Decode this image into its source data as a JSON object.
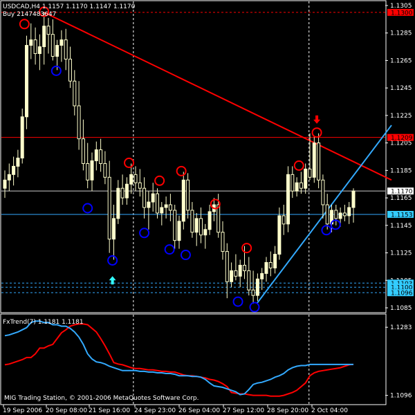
{
  "chart_data": [
    {
      "type": "candlestick",
      "title": "USDCAD,H4  1.1157 1.1170 1.1147 1.1170",
      "order_label": "Buy 2147483647",
      "copyright": "MIG Trading Station, © 2001-2006 MetaQuotes Software Corp.",
      "ylim": [
        1.1082,
        1.1308
      ],
      "y_ticks": [
        "1.1305",
        "1.1285",
        "1.1265",
        "1.1245",
        "1.1225",
        "1.1205",
        "1.1185",
        "1.1165",
        "1.1145",
        "1.1125",
        "1.1105",
        "1.1085"
      ],
      "x_ticks": [
        "19 Sep 2006",
        "20 Sep 08:00",
        "21 Sep 16:00",
        "24 Sep 23:00",
        "26 Sep 04:00",
        "27 Sep 12:00",
        "28 Sep 20:00",
        "2 Oct 04:00"
      ],
      "price_tags": [
        {
          "label": "1.1300",
          "value": 1.13,
          "color": "#ff0000",
          "text_color": "#000000"
        },
        {
          "label": "1.1209",
          "value": 1.1209,
          "color": "#ff0000",
          "text_color": "#000000"
        },
        {
          "label": "1.1170",
          "value": 1.117,
          "color": "#ffffff",
          "text_color": "#000000"
        },
        {
          "label": "1.1153",
          "value": 1.1153,
          "color": "#33ccff",
          "text_color": "#000000"
        },
        {
          "label": "1.1103",
          "value": 1.1103,
          "color": "#33ccff",
          "text_color": "#000000"
        },
        {
          "label": "1.1100",
          "value": 1.11,
          "color": "#33ccff",
          "text_color": "#000000"
        },
        {
          "label": "1.1096",
          "value": 1.1096,
          "color": "#33ccff",
          "text_color": "#000000"
        }
      ],
      "candles": [
        {
          "o": 1.1172,
          "h": 1.1185,
          "l": 1.1165,
          "c": 1.1178
        },
        {
          "o": 1.1178,
          "h": 1.119,
          "l": 1.117,
          "c": 1.1182
        },
        {
          "o": 1.1182,
          "h": 1.1195,
          "l": 1.1174,
          "c": 1.1188
        },
        {
          "o": 1.1188,
          "h": 1.12,
          "l": 1.118,
          "c": 1.1194
        },
        {
          "o": 1.1194,
          "h": 1.123,
          "l": 1.119,
          "c": 1.1224
        },
        {
          "o": 1.1224,
          "h": 1.1283,
          "l": 1.1215,
          "c": 1.1276
        },
        {
          "o": 1.1276,
          "h": 1.1292,
          "l": 1.1266,
          "c": 1.128
        },
        {
          "o": 1.128,
          "h": 1.1289,
          "l": 1.1262,
          "c": 1.127
        },
        {
          "o": 1.127,
          "h": 1.1284,
          "l": 1.1258,
          "c": 1.1275
        },
        {
          "o": 1.1275,
          "h": 1.13,
          "l": 1.1262,
          "c": 1.129
        },
        {
          "o": 1.129,
          "h": 1.1296,
          "l": 1.127,
          "c": 1.1284
        },
        {
          "o": 1.1284,
          "h": 1.1295,
          "l": 1.1265,
          "c": 1.1268
        },
        {
          "o": 1.1268,
          "h": 1.128,
          "l": 1.1258,
          "c": 1.1276
        },
        {
          "o": 1.1276,
          "h": 1.1287,
          "l": 1.1264,
          "c": 1.128
        },
        {
          "o": 1.128,
          "h": 1.1288,
          "l": 1.1258,
          "c": 1.1266
        },
        {
          "o": 1.1266,
          "h": 1.1275,
          "l": 1.1245,
          "c": 1.125
        },
        {
          "o": 1.125,
          "h": 1.1258,
          "l": 1.1225,
          "c": 1.1232
        },
        {
          "o": 1.1232,
          "h": 1.125,
          "l": 1.12,
          "c": 1.1208
        },
        {
          "o": 1.1208,
          "h": 1.1222,
          "l": 1.1185,
          "c": 1.119
        },
        {
          "o": 1.119,
          "h": 1.1205,
          "l": 1.1172,
          "c": 1.1178
        },
        {
          "o": 1.1178,
          "h": 1.1198,
          "l": 1.117,
          "c": 1.1192
        },
        {
          "o": 1.1192,
          "h": 1.1206,
          "l": 1.1185,
          "c": 1.12
        },
        {
          "o": 1.12,
          "h": 1.1208,
          "l": 1.1184,
          "c": 1.119
        },
        {
          "o": 1.119,
          "h": 1.1199,
          "l": 1.1175,
          "c": 1.118
        },
        {
          "o": 1.118,
          "h": 1.1192,
          "l": 1.1125,
          "c": 1.1135
        },
        {
          "o": 1.1135,
          "h": 1.116,
          "l": 1.112,
          "c": 1.115
        },
        {
          "o": 1.115,
          "h": 1.1178,
          "l": 1.1146,
          "c": 1.1172
        },
        {
          "o": 1.1172,
          "h": 1.1182,
          "l": 1.116,
          "c": 1.1165
        },
        {
          "o": 1.1165,
          "h": 1.118,
          "l": 1.116,
          "c": 1.1175
        },
        {
          "o": 1.1175,
          "h": 1.119,
          "l": 1.1168,
          "c": 1.1182
        },
        {
          "o": 1.1182,
          "h": 1.1188,
          "l": 1.117,
          "c": 1.1176
        },
        {
          "o": 1.1176,
          "h": 1.1186,
          "l": 1.1166,
          "c": 1.1172
        },
        {
          "o": 1.1172,
          "h": 1.118,
          "l": 1.115,
          "c": 1.1158
        },
        {
          "o": 1.1158,
          "h": 1.117,
          "l": 1.1142,
          "c": 1.1162
        },
        {
          "o": 1.1162,
          "h": 1.1176,
          "l": 1.1155,
          "c": 1.1168
        },
        {
          "o": 1.1168,
          "h": 1.1172,
          "l": 1.115,
          "c": 1.1154
        },
        {
          "o": 1.1154,
          "h": 1.1162,
          "l": 1.1145,
          "c": 1.1158
        },
        {
          "o": 1.1158,
          "h": 1.1166,
          "l": 1.115,
          "c": 1.116
        },
        {
          "o": 1.116,
          "h": 1.1168,
          "l": 1.1148,
          "c": 1.1156
        },
        {
          "o": 1.1156,
          "h": 1.116,
          "l": 1.1128,
          "c": 1.1134
        },
        {
          "o": 1.1134,
          "h": 1.1152,
          "l": 1.1128,
          "c": 1.1148
        },
        {
          "o": 1.1148,
          "h": 1.1184,
          "l": 1.1142,
          "c": 1.1178
        },
        {
          "o": 1.1178,
          "h": 1.1183,
          "l": 1.115,
          "c": 1.1156
        },
        {
          "o": 1.1156,
          "h": 1.1162,
          "l": 1.1136,
          "c": 1.114
        },
        {
          "o": 1.114,
          "h": 1.1154,
          "l": 1.113,
          "c": 1.115
        },
        {
          "o": 1.115,
          "h": 1.1158,
          "l": 1.1132,
          "c": 1.1138
        },
        {
          "o": 1.1138,
          "h": 1.1146,
          "l": 1.1128,
          "c": 1.1142
        },
        {
          "o": 1.1142,
          "h": 1.116,
          "l": 1.1138,
          "c": 1.1155
        },
        {
          "o": 1.1155,
          "h": 1.1165,
          "l": 1.1148,
          "c": 1.116
        },
        {
          "o": 1.116,
          "h": 1.1168,
          "l": 1.1136,
          "c": 1.114
        },
        {
          "o": 1.114,
          "h": 1.1148,
          "l": 1.112,
          "c": 1.1126
        },
        {
          "o": 1.1126,
          "h": 1.1132,
          "l": 1.1092,
          "c": 1.1104
        },
        {
          "o": 1.1104,
          "h": 1.1118,
          "l": 1.11,
          "c": 1.1112
        },
        {
          "o": 1.1112,
          "h": 1.1124,
          "l": 1.1105,
          "c": 1.1108
        },
        {
          "o": 1.1108,
          "h": 1.112,
          "l": 1.11,
          "c": 1.1116
        },
        {
          "o": 1.1116,
          "h": 1.113,
          "l": 1.1106,
          "c": 1.1112
        },
        {
          "o": 1.1112,
          "h": 1.1122,
          "l": 1.1094,
          "c": 1.1098
        },
        {
          "o": 1.1098,
          "h": 1.1112,
          "l": 1.1088,
          "c": 1.1094
        },
        {
          "o": 1.1094,
          "h": 1.111,
          "l": 1.109,
          "c": 1.1106
        },
        {
          "o": 1.1106,
          "h": 1.1114,
          "l": 1.1098,
          "c": 1.111
        },
        {
          "o": 1.111,
          "h": 1.1122,
          "l": 1.1104,
          "c": 1.1118
        },
        {
          "o": 1.1118,
          "h": 1.1126,
          "l": 1.1108,
          "c": 1.1114
        },
        {
          "o": 1.1114,
          "h": 1.113,
          "l": 1.111,
          "c": 1.1124
        },
        {
          "o": 1.1124,
          "h": 1.1158,
          "l": 1.112,
          "c": 1.1152
        },
        {
          "o": 1.1152,
          "h": 1.116,
          "l": 1.1138,
          "c": 1.1146
        },
        {
          "o": 1.1146,
          "h": 1.1188,
          "l": 1.114,
          "c": 1.1182
        },
        {
          "o": 1.1182,
          "h": 1.1188,
          "l": 1.1165,
          "c": 1.117
        },
        {
          "o": 1.117,
          "h": 1.118,
          "l": 1.1166,
          "c": 1.1176
        },
        {
          "o": 1.1176,
          "h": 1.1184,
          "l": 1.1168,
          "c": 1.1172
        },
        {
          "o": 1.1172,
          "h": 1.119,
          "l": 1.1168,
          "c": 1.1186
        },
        {
          "o": 1.1186,
          "h": 1.1212,
          "l": 1.1178,
          "c": 1.118
        },
        {
          "o": 1.118,
          "h": 1.121,
          "l": 1.1176,
          "c": 1.1205
        },
        {
          "o": 1.1205,
          "h": 1.1212,
          "l": 1.1172,
          "c": 1.1178
        },
        {
          "o": 1.1178,
          "h": 1.1182,
          "l": 1.115,
          "c": 1.116
        },
        {
          "o": 1.116,
          "h": 1.1168,
          "l": 1.1142,
          "c": 1.1146
        },
        {
          "o": 1.1146,
          "h": 1.116,
          "l": 1.114,
          "c": 1.1156
        },
        {
          "o": 1.1156,
          "h": 1.116,
          "l": 1.1145,
          "c": 1.115
        },
        {
          "o": 1.115,
          "h": 1.1158,
          "l": 1.1144,
          "c": 1.1154
        },
        {
          "o": 1.1154,
          "h": 1.116,
          "l": 1.1148,
          "c": 1.1152
        },
        {
          "o": 1.1152,
          "h": 1.1162,
          "l": 1.1146,
          "c": 1.1158
        },
        {
          "o": 1.1158,
          "h": 1.1172,
          "l": 1.1147,
          "c": 1.117
        }
      ],
      "trendlines": [
        {
          "name": "resistance",
          "color": "#ff0000",
          "from": {
            "i": 9.0,
            "v": 1.13
          },
          "to": {
            "i": 80.9,
            "v": 1.119
          }
        },
        {
          "name": "support",
          "color": "#33aaff",
          "from": {
            "i": 57.8,
            "v": 1.1088
          },
          "to": {
            "i": 80.9,
            "v": 1.1185
          }
        }
      ],
      "top_fractals": [
        {
          "i": 4.5,
          "v": 1.1291
        },
        {
          "i": 9.0,
          "v": 1.13
        },
        {
          "i": 28.5,
          "v": 1.119
        },
        {
          "i": 35.5,
          "v": 1.1177
        },
        {
          "i": 40.5,
          "v": 1.1184
        },
        {
          "i": 48.3,
          "v": 1.116
        },
        {
          "i": 55.5,
          "v": 1.1128
        },
        {
          "i": 67.5,
          "v": 1.1188
        },
        {
          "i": 71.6,
          "v": 1.1212
        }
      ],
      "bottom_fractals": [
        {
          "i": 11.8,
          "v": 1.1258
        },
        {
          "i": 19.0,
          "v": 1.1158
        },
        {
          "i": 24.7,
          "v": 1.112
        },
        {
          "i": 32.0,
          "v": 1.114
        },
        {
          "i": 37.8,
          "v": 1.1128
        },
        {
          "i": 41.5,
          "v": 1.1124
        },
        {
          "i": 53.5,
          "v": 1.109
        },
        {
          "i": 57.3,
          "v": 1.1086
        },
        {
          "i": 73.8,
          "v": 1.1142
        },
        {
          "i": 75.9,
          "v": 1.1146
        }
      ],
      "arrows": [
        {
          "i": 24.7,
          "dir": "up",
          "v": 1.1105,
          "color": "#33ffff"
        },
        {
          "i": 71.6,
          "dir": "down",
          "v": 1.1222,
          "color": "#ff0000"
        }
      ],
      "h_lines": [
        {
          "v": 1.13,
          "color": "#ff0000",
          "style": "dashed"
        },
        {
          "v": 1.1209,
          "color": "#ff0000",
          "style": "solid"
        },
        {
          "v": 1.117,
          "color": "#cccccc",
          "style": "solid"
        },
        {
          "v": 1.1153,
          "color": "#33aaff",
          "style": "solid"
        },
        {
          "v": 1.1103,
          "color": "#33aaff",
          "style": "dashed"
        },
        {
          "v": 1.11,
          "color": "#33aaff",
          "style": "dashed"
        },
        {
          "v": 1.1096,
          "color": "#33aaff",
          "style": "dashed"
        }
      ],
      "v_lines_i": [
        29.5,
        69.8
      ]
    },
    {
      "type": "line",
      "title": "FxTrend(7) 1.1181 1.1181",
      "y_ticks": [
        "1.1283",
        "1.1096"
      ],
      "ylim": [
        1.1082,
        1.1308
      ],
      "series": [
        {
          "color": "#ff0000",
          "values": [
            1.118,
            1.1182,
            1.1186,
            1.119,
            1.1194,
            1.12,
            1.12,
            1.121,
            1.1226,
            1.1226,
            1.1232,
            1.1236,
            1.1252,
            1.1268,
            1.1276,
            1.1286,
            1.129,
            1.1292,
            1.1292,
            1.129,
            1.128,
            1.127,
            1.1252,
            1.1232,
            1.121,
            1.1186,
            1.1182,
            1.118,
            1.1176,
            1.1172,
            1.117,
            1.117,
            1.1168,
            1.1166,
            1.1166,
            1.1164,
            1.1162,
            1.1162,
            1.116,
            1.116,
            1.1156,
            1.1152,
            1.115,
            1.115,
            1.1148,
            1.1146,
            1.1144,
            1.114,
            1.1138,
            1.1134,
            1.1128,
            1.112,
            1.1104,
            1.1102,
            1.11,
            1.11,
            1.1098,
            1.1096,
            1.1096,
            1.1096,
            1.1096,
            1.1094,
            1.1094,
            1.1094,
            1.1096,
            1.11,
            1.1104,
            1.111,
            1.112,
            1.113,
            1.115,
            1.1158,
            1.1162,
            1.1164,
            1.1166,
            1.1168,
            1.117,
            1.1172,
            1.1176,
            1.118,
            1.1181
          ]
        },
        {
          "color": "#33aaff",
          "values": [
            1.126,
            1.1262,
            1.1266,
            1.127,
            1.1276,
            1.1282,
            1.1296,
            1.13,
            1.13,
            1.1296,
            1.1296,
            1.129,
            1.129,
            1.1286,
            1.1286,
            1.128,
            1.127,
            1.1256,
            1.1236,
            1.121,
            1.1196,
            1.1188,
            1.1186,
            1.1182,
            1.1176,
            1.1172,
            1.1168,
            1.1164,
            1.1164,
            1.1164,
            1.1164,
            1.1162,
            1.1162,
            1.116,
            1.116,
            1.1158,
            1.1158,
            1.1156,
            1.1156,
            1.1154,
            1.115,
            1.115,
            1.115,
            1.1148,
            1.1148,
            1.1146,
            1.114,
            1.113,
            1.1122,
            1.112,
            1.1118,
            1.1114,
            1.111,
            1.1106,
            1.1098,
            1.11,
            1.1112,
            1.1126,
            1.113,
            1.1132,
            1.1136,
            1.114,
            1.1146,
            1.115,
            1.1156,
            1.1166,
            1.1172,
            1.1176,
            1.1178,
            1.1178,
            1.1181,
            1.1181,
            1.1181,
            1.1181,
            1.1181,
            1.1181,
            1.1181,
            1.1181,
            1.1181,
            1.1181,
            1.1181
          ]
        }
      ]
    }
  ],
  "colors": {
    "background": "#000000",
    "grid": "#ffffff",
    "bull_body": "#ffffcc",
    "bear_body": "#000000",
    "wick": "#ffffcc",
    "top_fractal": "#ff0000",
    "bottom_fractal": "#0000ff"
  }
}
